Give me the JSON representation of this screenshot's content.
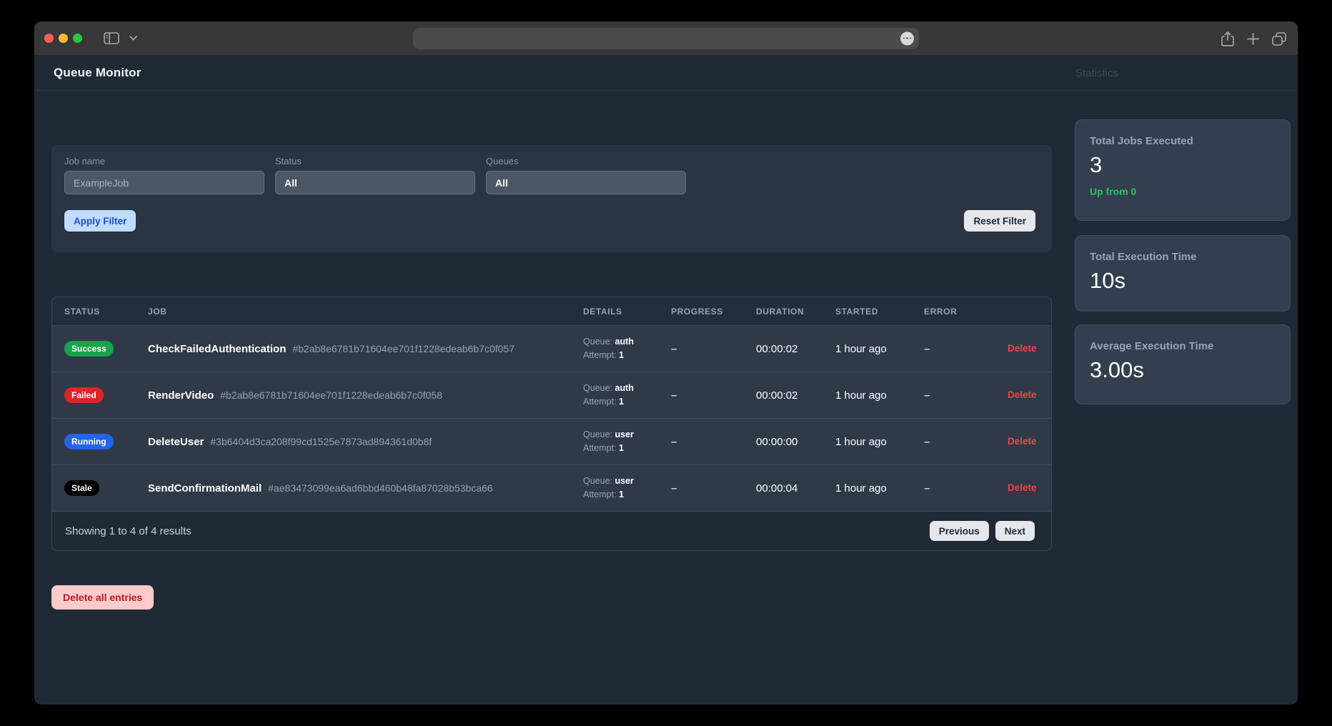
{
  "app": {
    "title": "Queue Monitor",
    "sidebar_title": "Statistics"
  },
  "filters": {
    "job_name": {
      "label": "Job name",
      "placeholder": "ExampleJob",
      "value": ""
    },
    "status": {
      "label": "Status",
      "value": "All"
    },
    "queues": {
      "label": "Queues",
      "value": "All"
    },
    "apply_label": "Apply Filter",
    "reset_label": "Reset Filter"
  },
  "table": {
    "columns": [
      "STATUS",
      "JOB",
      "DETAILS",
      "PROGRESS",
      "DURATION",
      "STARTED",
      "ERROR"
    ],
    "labels": {
      "queue": "Queue:",
      "attempt": "Attempt:"
    },
    "rows": [
      {
        "status": "Success",
        "status_color": "#16a34a",
        "job": "CheckFailedAuthentication",
        "hash": "#b2ab8e6781b71604ee701f1228edeab6b7c0f057",
        "queue": "auth",
        "attempt": "1",
        "progress": "–",
        "duration": "00:00:02",
        "started": "1 hour ago",
        "error": "–",
        "action": "Delete"
      },
      {
        "status": "Failed",
        "status_color": "#dc2626",
        "job": "RenderVideo",
        "hash": "#b2ab8e6781b71604ee701f1228edeab6b7c0f058",
        "queue": "auth",
        "attempt": "1",
        "progress": "–",
        "duration": "00:00:02",
        "started": "1 hour ago",
        "error": "–",
        "action": "Delete"
      },
      {
        "status": "Running",
        "status_color": "#2563eb",
        "job": "DeleteUser",
        "hash": "#3b6404d3ca208f99cd1525e7873ad894361d0b8f",
        "queue": "user",
        "attempt": "1",
        "progress": "–",
        "duration": "00:00:00",
        "started": "1 hour ago",
        "error": "–",
        "action": "Delete"
      },
      {
        "status": "Stale",
        "status_color": "#000000",
        "job": "SendConfirmationMail",
        "hash": "#ae83473099ea6ad6bbd460b48fa87028b53bca66",
        "queue": "user",
        "attempt": "1",
        "progress": "–",
        "duration": "00:00:04",
        "started": "1 hour ago",
        "error": "–",
        "action": "Delete"
      }
    ],
    "footer": {
      "summary": "Showing 1 to 4 of 4 results",
      "previous_label": "Previous",
      "next_label": "Next"
    }
  },
  "actions": {
    "delete_all_label": "Delete all entries"
  },
  "stats": [
    {
      "label": "Total Jobs Executed",
      "value": "3",
      "sub": "Up from 0",
      "sub_color": "#22c55e"
    },
    {
      "label": "Total Execution Time",
      "value": "10s"
    },
    {
      "label": "Average Execution Time",
      "value": "3.00s"
    }
  ],
  "colors": {
    "success": "#16a34a",
    "failed": "#dc2626",
    "running": "#2563eb",
    "stale": "#000000",
    "delete_link": "#ef4444",
    "accent_blue": "#bfdbfe",
    "up_from": "#22c55e"
  }
}
